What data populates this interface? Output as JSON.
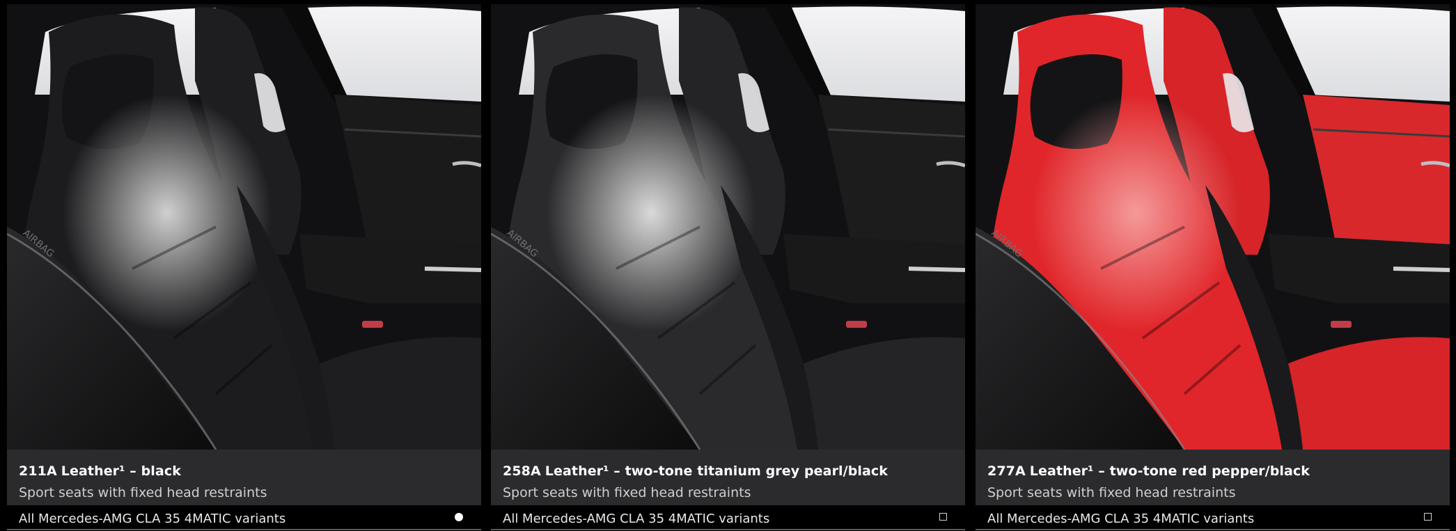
{
  "options": [
    {
      "code": "211A",
      "name": "Leather¹ – black",
      "description": "Sport seats with fixed head restraints",
      "variants": "All Mercedes-AMG CLA 35 4MATIC variants",
      "selected": true,
      "seat_color": "#1c1c1e",
      "seat_highlight": "#d9d9d9",
      "door_color": "#1a1a1b",
      "rear_seat_color": "#1e1e20"
    },
    {
      "code": "258A",
      "name": "Leather¹ – two-tone titanium grey pearl/black",
      "description": "Sport seats with fixed head restraints",
      "variants": "All Mercedes-AMG CLA 35 4MATIC variants",
      "selected": false,
      "seat_color": "#2a2a2c",
      "seat_highlight": "#e3e3e3",
      "door_color": "#1c1c1d",
      "rear_seat_color": "#242426"
    },
    {
      "code": "277A",
      "name": "Leather¹ – two-tone red pepper/black",
      "description": "Sport seats with fixed head restraints",
      "variants": "All Mercedes-AMG CLA 35 4MATIC variants",
      "selected": false,
      "seat_color": "#e0262a",
      "seat_highlight": "#f6a0a0",
      "door_color": "#d8282b",
      "rear_seat_color": "#d62428"
    }
  ],
  "photo_text": "AIRBAG"
}
